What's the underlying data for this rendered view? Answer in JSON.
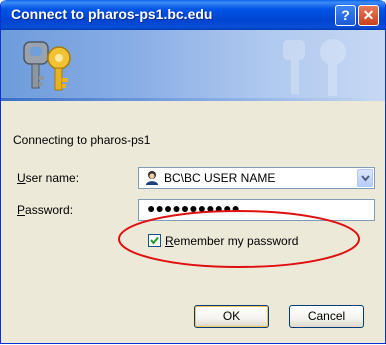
{
  "window": {
    "title": "Connect to pharos-ps1.bc.edu",
    "help_glyph": "?",
    "close_glyph": "✕"
  },
  "banner": {
    "icon": "keys-icon"
  },
  "status_text": "Connecting to pharos-ps1",
  "form": {
    "username_label_accel": "U",
    "username_label_rest": "ser name:",
    "username_value": "BC\\BC USER NAME",
    "password_label_accel": "P",
    "password_label_rest": "assword:",
    "password_mask": "●●●●●●●●●●●",
    "remember_accel": "R",
    "remember_rest": "emember my password",
    "remember_checked": true
  },
  "buttons": {
    "ok": "OK",
    "cancel": "Cancel"
  },
  "colors": {
    "titlebar": "#0055e5",
    "annotation_oval": "#e01010",
    "dialog_bg": "#ece9d8"
  }
}
